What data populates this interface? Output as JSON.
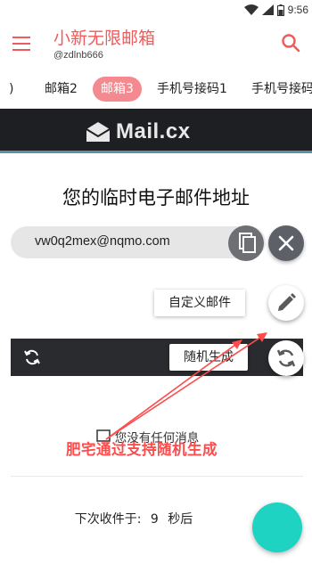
{
  "status": {
    "time": "9:56"
  },
  "app": {
    "title": "小新无限邮箱",
    "subtitle": "@zdlnb666"
  },
  "tabs": [
    {
      "label": ")"
    },
    {
      "label": "邮箱2"
    },
    {
      "label": "邮箱3"
    },
    {
      "label": "手机号接码1"
    },
    {
      "label": "手机号接码"
    }
  ],
  "banner": {
    "brand": "Mail.cx"
  },
  "main": {
    "heading": "您的临时电子邮件地址",
    "email": "vw0q2mex@nqmo.com"
  },
  "actions": {
    "custom_label": "自定义邮件",
    "random_label": "随机生成"
  },
  "inbox": {
    "empty": "您没有任何消息",
    "next_label": "下次收件于:",
    "next_value": "9",
    "next_unit": "秒后"
  },
  "annotation": {
    "text": "肥宅通过支持随机生成"
  },
  "colors": {
    "accent": "#f05a5a",
    "tab_active": "#f48a8f",
    "fab": "#1fd3c2",
    "annotation": "#ff4b4b"
  }
}
